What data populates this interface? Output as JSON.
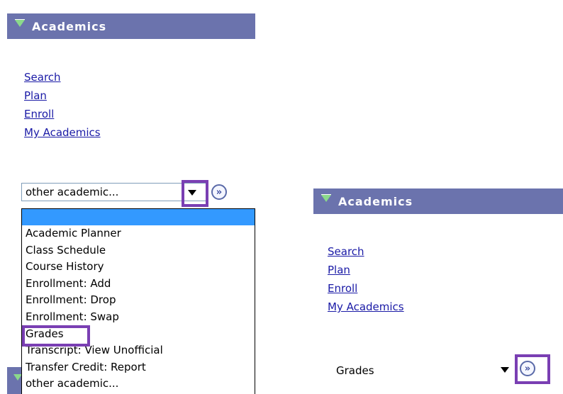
{
  "left_panel": {
    "header_title": "Academics",
    "links": [
      {
        "label": "Search"
      },
      {
        "label": "Plan"
      },
      {
        "label": "Enroll"
      },
      {
        "label": "My Academics"
      }
    ],
    "select_value": "other academic...",
    "go_button_glyph": "»",
    "dropdown_options": [
      {
        "label": ""
      },
      {
        "label": "Academic Planner"
      },
      {
        "label": "Class Schedule"
      },
      {
        "label": "Course History"
      },
      {
        "label": "Enrollment: Add"
      },
      {
        "label": "Enrollment: Drop"
      },
      {
        "label": "Enrollment: Swap"
      },
      {
        "label": "Grades"
      },
      {
        "label": "Transcript: View Unofficial"
      },
      {
        "label": "Transfer Credit: Report"
      },
      {
        "label": "other academic..."
      }
    ]
  },
  "right_panel": {
    "header_title": "Academics",
    "links": [
      {
        "label": "Search"
      },
      {
        "label": "Plan"
      },
      {
        "label": "Enroll"
      },
      {
        "label": "My Academics"
      }
    ],
    "select_value": "Grades",
    "go_button_glyph": "»"
  },
  "colors": {
    "header_bg": "#6b73ad",
    "header_triangle": "#8bd98b",
    "link": "#1a1aa6",
    "highlight_border": "#7a3fb3",
    "selected_option_bg": "#3399ff"
  },
  "icons": {
    "collapse": "triangle-down-icon",
    "dropdown": "chevron-down-icon",
    "go": "double-arrow-right-icon"
  }
}
